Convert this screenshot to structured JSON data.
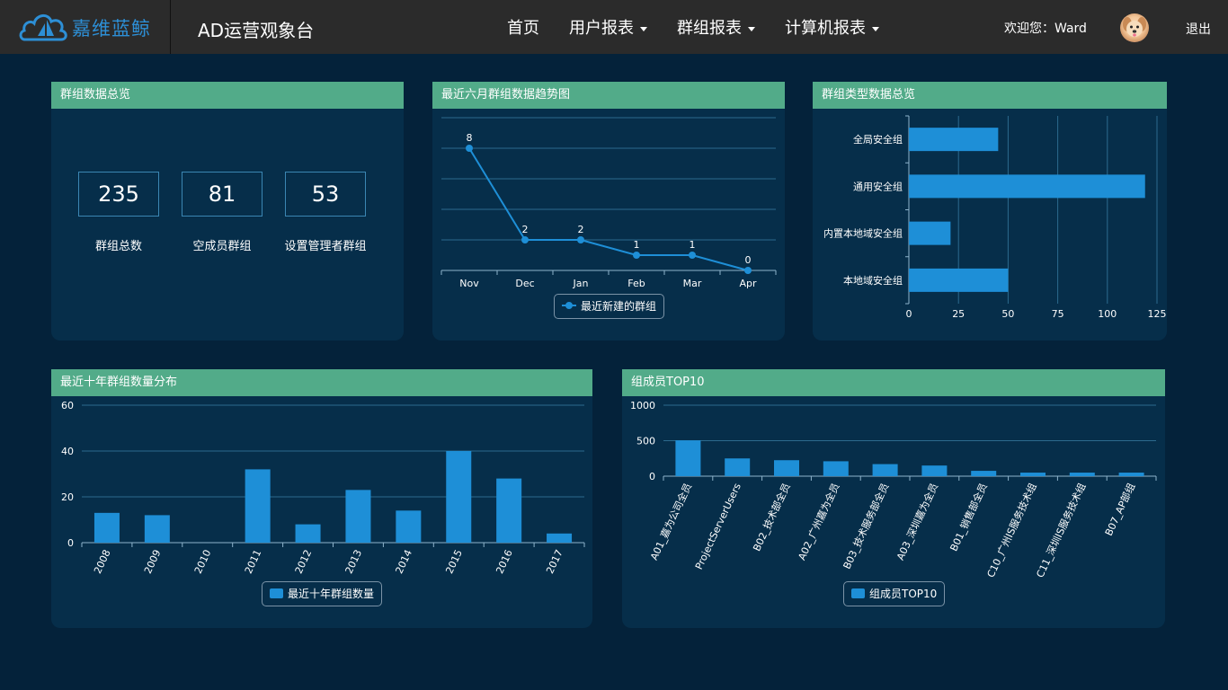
{
  "header": {
    "logo_text": "嘉维蓝鲸",
    "app_title": "AD运营观象台",
    "nav": [
      {
        "label": "首页",
        "has_dropdown": false
      },
      {
        "label": "用户报表",
        "has_dropdown": true
      },
      {
        "label": "群组报表",
        "has_dropdown": true
      },
      {
        "label": "计算机报表",
        "has_dropdown": true
      }
    ],
    "welcome": "欢迎您：Ward",
    "logout": "退出",
    "logo_icon": "cloud-logo-icon",
    "avatar_icon": "dog-avatar-icon"
  },
  "overview": {
    "title": "群组数据总览",
    "stats": [
      {
        "value": "235",
        "label": "群组总数"
      },
      {
        "value": "81",
        "label": "空成员群组"
      },
      {
        "value": "53",
        "label": "设置管理者群组"
      }
    ]
  },
  "colors": {
    "accent": "#52ab89",
    "bar": "#1e8fd7",
    "panel": "#062e4a",
    "background": "#04223a",
    "topbar": "#2b2b2b"
  },
  "chart_data": [
    {
      "id": "trend",
      "type": "line",
      "title": "最近六月群组数据趋势图",
      "categories": [
        "Nov",
        "Dec",
        "Jan",
        "Feb",
        "Mar",
        "Apr"
      ],
      "series": [
        {
          "name": "最近新建的群组",
          "values": [
            8,
            2,
            2,
            1,
            1,
            0
          ]
        }
      ],
      "ylim": [
        0,
        10
      ],
      "grid": true,
      "y_axis_labels": false,
      "data_labels": true,
      "legend": "bottom"
    },
    {
      "id": "types",
      "type": "bar",
      "orientation": "horizontal",
      "title": "群组类型数据总览",
      "categories": [
        "全局安全组",
        "通用安全组",
        "内置本地域安全组",
        "本地域安全组"
      ],
      "values": [
        45,
        119,
        21,
        50
      ],
      "xlim": [
        0,
        125
      ],
      "x_ticks": [
        0,
        25,
        50,
        75,
        100,
        125
      ],
      "grid": true
    },
    {
      "id": "years",
      "type": "bar",
      "title": "最近十年群组数量分布",
      "categories": [
        "2008",
        "2009",
        "2010",
        "2011",
        "2012",
        "2013",
        "2014",
        "2015",
        "2016",
        "2017"
      ],
      "series": [
        {
          "name": "最近十年群组数量",
          "values": [
            13,
            12,
            0,
            32,
            8,
            23,
            14,
            40,
            28,
            4
          ]
        }
      ],
      "ylim": [
        0,
        60
      ],
      "y_ticks": [
        0,
        20,
        40,
        60
      ],
      "grid": true,
      "legend": "bottom"
    },
    {
      "id": "top10",
      "type": "bar",
      "title": "组成员TOP10",
      "categories": [
        "A01_嘉为公司全员",
        "ProjectServerUsers",
        "B02_技术部全员",
        "A02_广州嘉为全员",
        "B03_技术服务部全员",
        "A03_深圳嘉为全员",
        "B01_销售部全员",
        "C10_广州IS服务技术组",
        "C11_深圳IS服务技术组",
        "B07_AP部组"
      ],
      "series": [
        {
          "name": "组成员TOP10",
          "values": [
            505,
            250,
            225,
            210,
            170,
            150,
            75,
            50,
            50,
            50
          ]
        }
      ],
      "ylim": [
        0,
        1000
      ],
      "y_ticks": [
        0,
        500,
        1000
      ],
      "grid": true,
      "legend": "bottom"
    }
  ]
}
